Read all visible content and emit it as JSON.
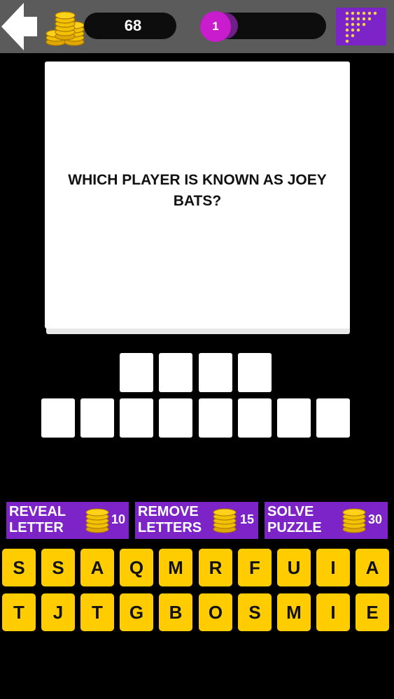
{
  "header": {
    "back_icon": "back-arrow-icon",
    "coins_icon": "coin-stack-icon",
    "coin_count": "68",
    "level_number": "1",
    "level_progress": 0.1,
    "levels_icon": "level-grid-icon"
  },
  "question": {
    "text": "WHICH PLAYER IS KNOWN AS JOEY BATS?"
  },
  "answer": {
    "row1_count": 4,
    "row2_count": 8
  },
  "helpers": [
    {
      "label": "REVEAL\nLETTER",
      "cost": "10",
      "icon": "coin-stack-icon"
    },
    {
      "label": "REMOVE\nLETTERS",
      "cost": "15",
      "icon": "coin-stack-icon"
    },
    {
      "label": "SOLVE\nPUZZLE",
      "cost": "30",
      "icon": "coin-stack-icon"
    }
  ],
  "keyboard": {
    "row1": [
      "S",
      "S",
      "A",
      "Q",
      "M",
      "R",
      "F",
      "U",
      "I",
      "A"
    ],
    "row2": [
      "T",
      "J",
      "T",
      "G",
      "B",
      "O",
      "S",
      "M",
      "I",
      "E"
    ]
  },
  "colors": {
    "accent_purple": "#7d24c9",
    "level_badge": "#c81ccd",
    "key_yellow": "#ffcc00",
    "topbar_gray": "#5b5b5b"
  }
}
